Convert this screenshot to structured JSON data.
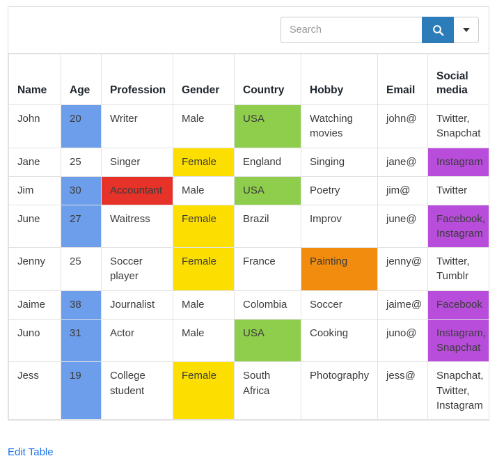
{
  "search": {
    "placeholder": "Search",
    "value": "",
    "search_button_icon": "search-icon",
    "dropdown_icon": "chevron-down-icon"
  },
  "colors": {
    "blue": "#6d9eeb",
    "yellow": "#fcdf00",
    "green": "#8fce4c",
    "red": "#e73229",
    "purple": "#b84ddb",
    "orange": "#f28c0e",
    "accent_button": "#2b7cb9",
    "link": "#1a73e8",
    "border": "#e2e2e2"
  },
  "table": {
    "columns": [
      "Name",
      "Age",
      "Profession",
      "Gender",
      "Country",
      "Hobby",
      "Email",
      "Social media"
    ],
    "rows": [
      {
        "name": "John",
        "name_hl": "",
        "age": "20",
        "age_hl": "blue",
        "profession": "Writer",
        "profession_hl": "",
        "gender": "Male",
        "gender_hl": "",
        "country": "USA",
        "country_hl": "green",
        "hobby": "Watching movies",
        "hobby_hl": "",
        "email": "john@",
        "email_hl": "",
        "social": "Twitter, Snapchat",
        "social_hl": ""
      },
      {
        "name": "Jane",
        "name_hl": "",
        "age": "25",
        "age_hl": "",
        "profession": "Singer",
        "profession_hl": "",
        "gender": "Female",
        "gender_hl": "yellow",
        "country": "England",
        "country_hl": "",
        "hobby": "Singing",
        "hobby_hl": "",
        "email": "jane@",
        "email_hl": "",
        "social": "Instagram",
        "social_hl": "purple"
      },
      {
        "name": "Jim",
        "name_hl": "",
        "age": "30",
        "age_hl": "blue",
        "profession": "Accountant",
        "profession_hl": "red",
        "gender": "Male",
        "gender_hl": "",
        "country": "USA",
        "country_hl": "green",
        "hobby": "Poetry",
        "hobby_hl": "",
        "email": "jim@",
        "email_hl": "",
        "social": "Twitter",
        "social_hl": ""
      },
      {
        "name": "June",
        "name_hl": "",
        "age": "27",
        "age_hl": "blue",
        "profession": "Waitress",
        "profession_hl": "",
        "gender": "Female",
        "gender_hl": "yellow",
        "country": "Brazil",
        "country_hl": "",
        "hobby": "Improv",
        "hobby_hl": "",
        "email": "june@",
        "email_hl": "",
        "social": "Facebook, Instagram",
        "social_hl": "purple"
      },
      {
        "name": "Jenny",
        "name_hl": "",
        "age": "25",
        "age_hl": "",
        "profession": "Soccer player",
        "profession_hl": "",
        "gender": "Female",
        "gender_hl": "yellow",
        "country": "France",
        "country_hl": "",
        "hobby": "Painting",
        "hobby_hl": "orange",
        "email": "jenny@",
        "email_hl": "",
        "social": "Twitter, Tumblr",
        "social_hl": ""
      },
      {
        "name": "Jaime",
        "name_hl": "",
        "age": "38",
        "age_hl": "blue",
        "profession": "Journalist",
        "profession_hl": "",
        "gender": "Male",
        "gender_hl": "",
        "country": "Colombia",
        "country_hl": "",
        "hobby": "Soccer",
        "hobby_hl": "",
        "email": "jaime@",
        "email_hl": "",
        "social": "Facebook",
        "social_hl": "purple"
      },
      {
        "name": "Juno",
        "name_hl": "",
        "age": "31",
        "age_hl": "blue",
        "profession": "Actor",
        "profession_hl": "",
        "gender": "Male",
        "gender_hl": "",
        "country": "USA",
        "country_hl": "green",
        "hobby": "Cooking",
        "hobby_hl": "",
        "email": "juno@",
        "email_hl": "",
        "social": "Instagram, Snapchat",
        "social_hl": "purple"
      },
      {
        "name": "Jess",
        "name_hl": "",
        "age": "19",
        "age_hl": "blue",
        "profession": "College student",
        "profession_hl": "",
        "gender": "Female",
        "gender_hl": "yellow",
        "country": "South Africa",
        "country_hl": "",
        "hobby": "Photography",
        "hobby_hl": "",
        "email": "jess@",
        "email_hl": "",
        "social": "Snapchat, Twitter, Instagram",
        "social_hl": ""
      }
    ]
  },
  "footer": {
    "edit_link": "Edit Table"
  }
}
